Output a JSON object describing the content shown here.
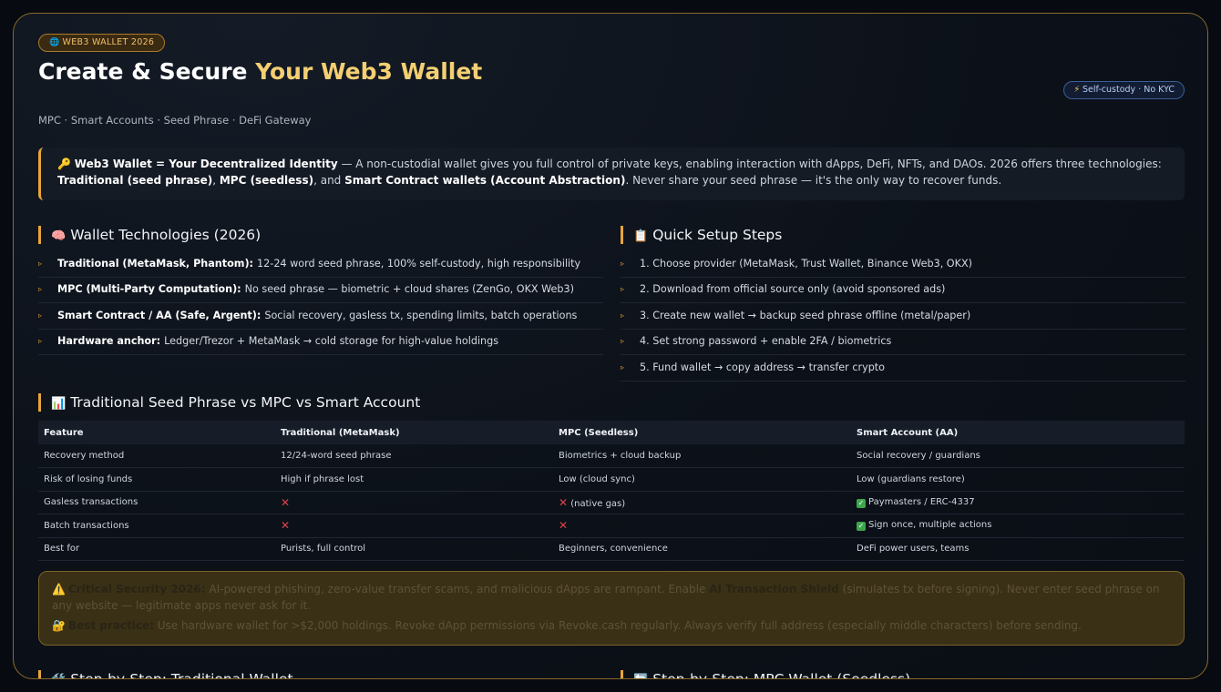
{
  "badge": {
    "icon": "globe-icon",
    "label": "WEB3 WALLET 2026"
  },
  "title": {
    "main": "Create & Secure ",
    "accent": "Your Web3 Wallet"
  },
  "right_badge": {
    "icon": "lightning-icon",
    "label": "Self-custody · No KYC"
  },
  "subtitle": "MPC · Smart Accounts · Seed Phrase · DeFi Gateway",
  "intro": {
    "icon": "key-icon",
    "lead": "Web3 Wallet = Your Decentralized Identity",
    "text1": " — A non-custodial wallet gives you full control of private keys, enabling interaction with dApps, DeFi, NFTs, and DAOs. 2026 offers three technologies: ",
    "b1": "Traditional (seed phrase)",
    "text2": ", ",
    "b2": "MPC (seedless)",
    "text3": ", and ",
    "b3": "Smart Contract wallets (Account Abstraction)",
    "text4": ". Never share your seed phrase — it's the only way to recover funds."
  },
  "tech": {
    "icon": "brain-icon",
    "heading": "Wallet Technologies (2026)",
    "items": [
      {
        "bold": "Traditional (MetaMask, Phantom):",
        "text": "12-24 word seed phrase, 100% self-custody, high responsibility"
      },
      {
        "bold": "MPC (Multi-Party Computation):",
        "text": "No seed phrase — biometric + cloud shares (ZenGo, OKX Web3)"
      },
      {
        "bold": "Smart Contract / AA (Safe, Argent):",
        "text": "Social recovery, gasless tx, spending limits, batch operations"
      },
      {
        "bold": "Hardware anchor:",
        "text": "Ledger/Trezor + MetaMask → cold storage for high-value holdings"
      }
    ]
  },
  "setup": {
    "icon": "clipboard-icon",
    "heading": "Quick Setup Steps",
    "items": [
      "1. Choose provider (MetaMask, Trust Wallet, Binance Web3, OKX)",
      "2. Download from official source only (avoid sponsored ads)",
      "3. Create new wallet → backup seed phrase offline (metal/paper)",
      "4. Set strong password + enable 2FA / biometrics",
      "5. Fund wallet → copy address → transfer crypto"
    ]
  },
  "compare": {
    "icon": "bar-chart-icon",
    "heading": "Traditional Seed Phrase vs MPC vs Smart Account",
    "headers": [
      "Feature",
      "Traditional (MetaMask)",
      "MPC (Seedless)",
      "Smart Account (AA)"
    ],
    "rows": [
      [
        "Recovery method",
        "12/24-word seed phrase",
        "Biometrics + cloud backup",
        "Social recovery / guardians"
      ],
      [
        "Risk of losing funds",
        "High if phrase lost",
        "Low (cloud sync)",
        "Low (guardians restore)"
      ],
      [
        "Gasless transactions",
        "",
        "(native gas)",
        "Paymasters / ERC-4337"
      ],
      [
        "Batch transactions",
        "",
        "",
        "Sign once, multiple actions"
      ],
      [
        "Best for",
        "Purists, full control",
        "Beginners, convenience",
        "DeFi power users, teams"
      ]
    ]
  },
  "warning": {
    "icon": "warning-icon",
    "lead": "Critical Security 2026:",
    "text1": " AI-powered phishing, zero-value transfer scams, and malicious dApps are rampant. Enable ",
    "b1": "AI Transaction Shield",
    "text2": " (simulates tx before signing). Never enter seed phrase on any website — legitimate apps never ask for it.",
    "icon2": "lock-icon",
    "lead2": "Best practice:",
    "text3": " Use hardware wallet for >$2,000 holdings. Revoke dApp permissions via Revoke.cash regularly. Always verify full address (especially middle characters) before sending."
  },
  "steps_trad": {
    "icon": "tools-icon",
    "heading": "Step-by-Step: Traditional Wallet"
  },
  "steps_mpc": {
    "icon": "refresh-icon",
    "heading": "Step-by-Step: MPC Wallet (Seedless)"
  },
  "colors": {
    "accent": "#e8a53c",
    "title_accent": "#f4cf72",
    "error": "#e0414a",
    "success": "#3da64d"
  }
}
